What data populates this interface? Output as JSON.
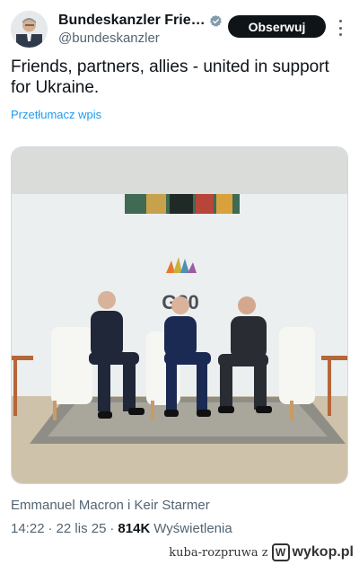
{
  "post": {
    "author_name": "Bundeskanzler Frie…",
    "handle": "@bundeskanzler",
    "follow_label": "Obserwuj",
    "text": "Friends, partners, allies - united in support for Ukraine.",
    "translate_label": "Przetłumacz wpis",
    "media_caption": "Emmanuel Macron i Keir Starmer",
    "time": "14:22",
    "date": "22 lis 25",
    "views_count": "814K",
    "views_label": "Wyświetlenia"
  },
  "media": {
    "backdrop_logo_text": "G20"
  },
  "watermark": {
    "user": "kuba-rozpruwa",
    "separator": "z",
    "site": "wykop.pl"
  },
  "colors": {
    "accent": "#1d9bf0",
    "verified": "#829aab",
    "text_primary": "#0f1419",
    "text_secondary": "#536471"
  },
  "icons": [
    "verified-badge-icon",
    "more-options-icon",
    "wykop-logo-icon"
  ]
}
